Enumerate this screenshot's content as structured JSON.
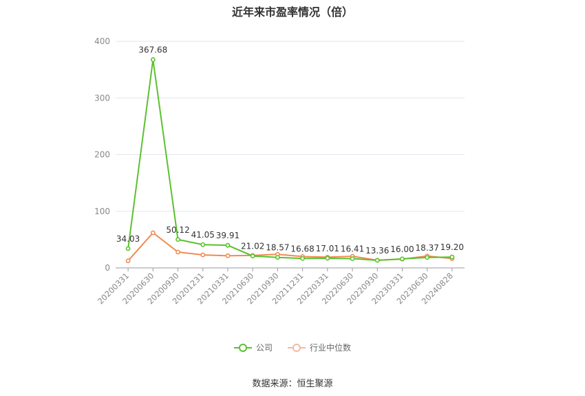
{
  "chart_data": {
    "type": "line",
    "title": "近年来市盈率情况（倍）",
    "categories": [
      "20200331",
      "20200630",
      "20200930",
      "20201231",
      "20210331",
      "20210630",
      "20210930",
      "20211231",
      "20220331",
      "20220630",
      "20220930",
      "20230331",
      "20230630",
      "20240828"
    ],
    "series": [
      {
        "name": "公司",
        "color": "#5ac12e",
        "values": [
          34.03,
          367.68,
          50.12,
          41.05,
          39.91,
          21.02,
          18.57,
          16.68,
          17.01,
          16.41,
          13.36,
          16.0,
          18.37,
          19.2
        ],
        "labels": [
          "34.03",
          "367.68",
          "50.12",
          "41.05",
          "39.91",
          "21.02",
          "18.57",
          "16.68",
          "17.01",
          "16.41",
          "13.36",
          "16.00",
          "18.37",
          "19.20"
        ]
      },
      {
        "name": "行业中位数",
        "color": "#f08a50",
        "values": [
          12.5,
          62.0,
          28.0,
          23.0,
          21.5,
          22.0,
          24.0,
          20.0,
          19.0,
          20.5,
          13.5,
          15.5,
          21.0,
          16.5
        ]
      }
    ],
    "ylim": [
      0,
      400
    ],
    "yticks": [
      0,
      100,
      200,
      300,
      400
    ],
    "grid": true,
    "legend": "bottom-center"
  },
  "footer": {
    "source": "数据来源：恒生聚源"
  }
}
